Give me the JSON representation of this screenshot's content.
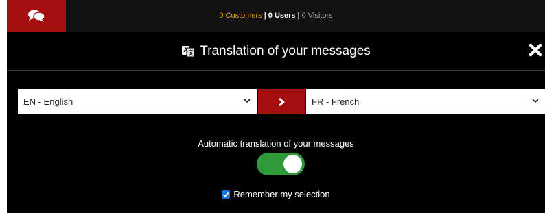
{
  "topbar": {
    "icon": "chat-bubbles-icon",
    "customers": "0 Customers",
    "users": "0 Users",
    "visitors": "0 Visitors",
    "separator": "|"
  },
  "header": {
    "icon": "translate-icon",
    "title": "Translation of your messages",
    "close_icon": "close-icon"
  },
  "languages": {
    "source": "EN - English",
    "target": "FR - French",
    "swap_icon": "chevron-right-icon"
  },
  "auto_translation": {
    "label": "Automatic translation of your messages",
    "enabled": true
  },
  "remember": {
    "label": "Remember my selection",
    "checked": true
  },
  "colors": {
    "accent_red": "#a50e0e",
    "toggle_green": "#2e9a3a",
    "checkbox_blue": "#1d6fe0",
    "customers_orange": "#e6a21a",
    "background": "#000000"
  }
}
